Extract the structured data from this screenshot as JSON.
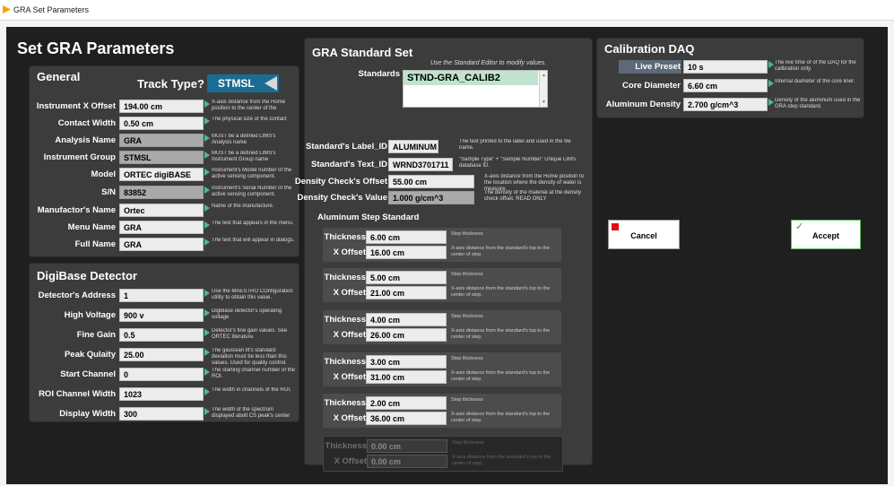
{
  "window": {
    "title": "GRA Set Parameters"
  },
  "main_title": "Set GRA Parameters",
  "general": {
    "title": "General",
    "track_type_label": "Track Type?",
    "track_type_value": "STMSL",
    "rows": [
      {
        "label": "Instrument X Offset",
        "value": "194.00 cm",
        "note": "X-axis distance from the Home position to the center of the"
      },
      {
        "label": "Contact Width",
        "value": "0.50 cm",
        "note": "The physical size of the contact"
      },
      {
        "label": "Analysis Name",
        "value": "GRA",
        "note": "MUST be a defined LIMS's Analysis name"
      },
      {
        "label": "Instrument Group",
        "value": "STMSL",
        "note": "MUST be a defined LIMS's Instrument Group name"
      },
      {
        "label": "Model",
        "value": "ORTEC digiBASE",
        "note": "Instrument's Model number of the active sensing component."
      },
      {
        "label": "S/N",
        "value": "83852",
        "note": "Instrument's Serial Number of the active sensing component."
      },
      {
        "label": "Manufactor's Name",
        "value": "Ortec",
        "note": "Name of the manufacture."
      },
      {
        "label": "Menu Name",
        "value": "GRA",
        "note": "The text that appears in the menu."
      },
      {
        "label": "Full Name",
        "value": "GRA",
        "note": "The text that will appear in dialogs."
      }
    ]
  },
  "digibase": {
    "title": "DigiBase Detector",
    "rows": [
      {
        "label": "Detector's Address",
        "value": "1",
        "note": "Use the MAESTRO COnfiguration utility to obtain this value."
      },
      {
        "label": "High Voltage",
        "value": "900 v",
        "note": "DigiBase detector's operating voltage"
      },
      {
        "label": "Fine Gain",
        "value": "0.5",
        "note": "Detector's fine gain values. See ORTEC literature."
      },
      {
        "label": "Peak Qulaity",
        "value": "25.00",
        "note": "The gaussian fit's standard deviation must be less than this values. Used for quality control."
      },
      {
        "label": "Start Channel",
        "value": "0",
        "note": "The starting channel number of the ROI."
      },
      {
        "label": "ROI Channel Width",
        "value": "1023",
        "note": "The width in channels of the ROI."
      },
      {
        "label": "Display Width",
        "value": "300",
        "note": "The width of the spectrum displayed abotl CS peak's center"
      }
    ]
  },
  "standard_set": {
    "title": "GRA Standard Set",
    "hint": "Use the Standard Editor to modify values.",
    "standards_label": "Standards",
    "standards_value": "STND-GRA_CALIB2",
    "label_id": {
      "label": "Standard's Label_ID",
      "value": "ALUMINUM",
      "note": "The text printed to the label and used in the file name."
    },
    "text_id": {
      "label": "Standard's Text_ID",
      "value": "WRND3701711",
      "note": "\"Sample Type\" + \"Sample Number\" Unique LIMS database ID."
    },
    "density_offset": {
      "label": "Density Check's Offset",
      "value": "55.00 cm",
      "note": "X-axis distance from the Home position to the location where the density of water is measure."
    },
    "density_value": {
      "label": "Density Check's Value",
      "value": "1.000 g/cm^3",
      "note": "The density of the material at the density check offset. READ ONLY"
    },
    "aluminum_title": "Aluminum Step Standard",
    "thickness_label": "Thickness",
    "offset_label": "X Offset",
    "thickness_note": "Step thickness",
    "offset_note": "X-axis distance from the standard's top to the center of step.",
    "steps": [
      {
        "thickness": "6.00 cm",
        "offset": "16.00 cm"
      },
      {
        "thickness": "5.00 cm",
        "offset": "21.00 cm"
      },
      {
        "thickness": "4.00 cm",
        "offset": "26.00 cm"
      },
      {
        "thickness": "3.00 cm",
        "offset": "31.00 cm"
      },
      {
        "thickness": "2.00 cm",
        "offset": "36.00 cm"
      },
      {
        "thickness": "0.00 cm",
        "offset": "0.00 cm"
      }
    ]
  },
  "daq": {
    "title": "Calibration DAQ",
    "live_preset": {
      "label": "Live Preset",
      "value": "10 s",
      "note": "The live time of of the DAQ for the calibration only."
    },
    "core_diameter": {
      "label": "Core Diameter",
      "value": "6.60 cm",
      "note": "Internal diameter of the core liner."
    },
    "aluminum_density": {
      "label": "Aluminum Density",
      "value": "2.700 g/cm^3",
      "note": "Density of the aluminum used in the GRA step standard."
    }
  },
  "buttons": {
    "cancel": "Cancel",
    "accept": "Accept"
  },
  "colors": {
    "accent_teal": "#46b9a0",
    "track_type_bg": "#1a6c93",
    "standards_bg": "#bfe3cf",
    "cancel_red": "#e01010",
    "accept_green": "#5cc05c"
  }
}
